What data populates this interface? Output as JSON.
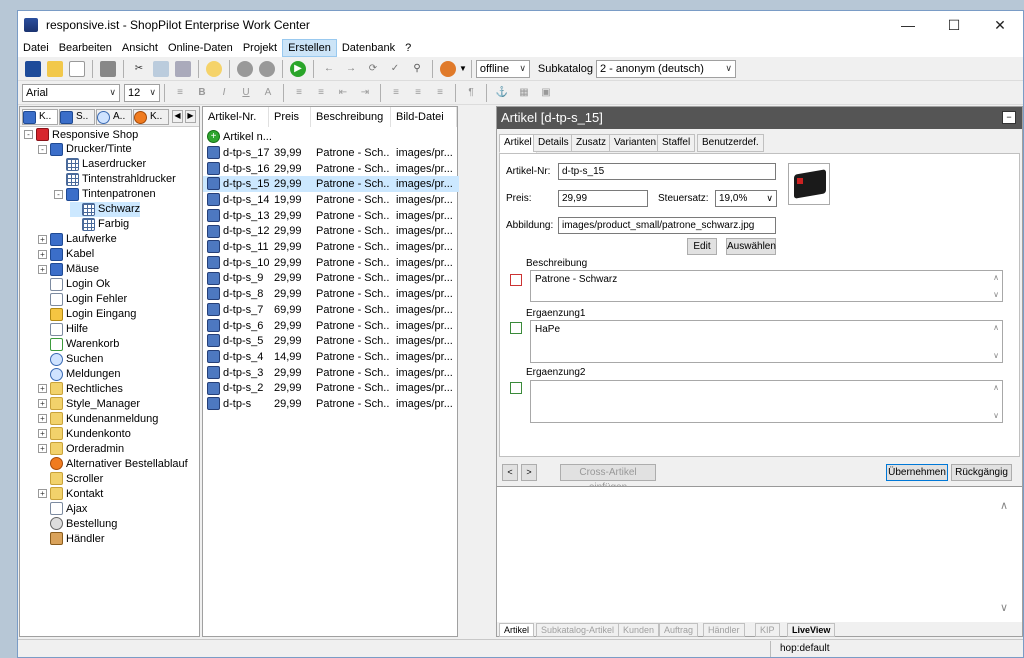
{
  "window": {
    "title": "responsive.ist - ShopPilot Enterprise Work Center"
  },
  "menu": [
    "Datei",
    "Bearbeiten",
    "Ansicht",
    "Online-Daten",
    "Projekt",
    "Erstellen",
    "Datenbank",
    "?"
  ],
  "toolbar1": {
    "status_value": "offline",
    "subkatalog_label": "Subkatalog",
    "subkatalog_value": "2 - anonym (deutsch)"
  },
  "toolbar2": {
    "font_value": "Arial",
    "size_value": "12"
  },
  "side_tabs": [
    "K..",
    "S..",
    "A..",
    "K.."
  ],
  "tree": [
    {
      "label": "Responsive Shop",
      "icon": "root",
      "level": 0,
      "exp": "-"
    },
    {
      "label": "Drucker/Tinte",
      "icon": "book",
      "level": 1,
      "exp": "-"
    },
    {
      "label": "Laserdrucker",
      "icon": "grid",
      "level": 2,
      "exp": ""
    },
    {
      "label": "Tintenstrahldrucker",
      "icon": "grid",
      "level": 2,
      "exp": ""
    },
    {
      "label": "Tintenpatronen",
      "icon": "book",
      "level": 2,
      "exp": "-"
    },
    {
      "label": "Schwarz",
      "icon": "grid",
      "level": 3,
      "exp": ""
    },
    {
      "label": "Farbig",
      "icon": "grid",
      "level": 3,
      "exp": ""
    },
    {
      "label": "Laufwerke",
      "icon": "book",
      "level": 1,
      "exp": "+"
    },
    {
      "label": "Kabel",
      "icon": "book",
      "level": 1,
      "exp": "+"
    },
    {
      "label": "Mäuse",
      "icon": "book",
      "level": 1,
      "exp": "+"
    },
    {
      "label": "Login Ok",
      "icon": "page",
      "level": 1,
      "exp": ""
    },
    {
      "label": "Login Fehler",
      "icon": "page",
      "level": 1,
      "exp": ""
    },
    {
      "label": "Login Eingang",
      "icon": "lock",
      "level": 1,
      "exp": ""
    },
    {
      "label": "Hilfe",
      "icon": "page",
      "level": 1,
      "exp": ""
    },
    {
      "label": "Warenkorb",
      "icon": "cart",
      "level": 1,
      "exp": ""
    },
    {
      "label": "Suchen",
      "icon": "search",
      "level": 1,
      "exp": ""
    },
    {
      "label": "Meldungen",
      "icon": "search",
      "level": 1,
      "exp": ""
    },
    {
      "label": "Rechtliches",
      "icon": "folder",
      "level": 1,
      "exp": "+"
    },
    {
      "label": "Style_Manager",
      "icon": "folder",
      "level": 1,
      "exp": "+"
    },
    {
      "label": "Kundenanmeldung",
      "icon": "folder",
      "level": 1,
      "exp": "+"
    },
    {
      "label": "Kundenkonto",
      "icon": "folder",
      "level": 1,
      "exp": "+"
    },
    {
      "label": "Orderadmin",
      "icon": "folder",
      "level": 1,
      "exp": "+"
    },
    {
      "label": "Alternativer Bestellablauf",
      "icon": "fox",
      "level": 1,
      "exp": ""
    },
    {
      "label": "Scroller",
      "icon": "folder",
      "level": 1,
      "exp": ""
    },
    {
      "label": "Kontakt",
      "icon": "folder",
      "level": 1,
      "exp": "+"
    },
    {
      "label": "Ajax",
      "icon": "page",
      "level": 1,
      "exp": ""
    },
    {
      "label": "Bestellung",
      "icon": "euro",
      "level": 1,
      "exp": ""
    },
    {
      "label": "Händler",
      "icon": "bag",
      "level": 1,
      "exp": ""
    }
  ],
  "list": {
    "headers": [
      "Artikel-Nr.",
      "Preis",
      "Beschreibung",
      "Bild-Datei"
    ],
    "new_label": "Artikel n...",
    "rows": [
      {
        "nr": "d-tp-s_17",
        "preis": "39,99",
        "beschr": "Patrone - Sch...",
        "bild": "images/pr..."
      },
      {
        "nr": "d-tp-s_16",
        "preis": "29,99",
        "beschr": "Patrone - Sch...",
        "bild": "images/pr..."
      },
      {
        "nr": "d-tp-s_15",
        "preis": "29,99",
        "beschr": "Patrone - Sch...",
        "bild": "images/pr..."
      },
      {
        "nr": "d-tp-s_14",
        "preis": "19,99",
        "beschr": "Patrone - Sch...",
        "bild": "images/pr..."
      },
      {
        "nr": "d-tp-s_13",
        "preis": "29,99",
        "beschr": "Patrone - Sch...",
        "bild": "images/pr..."
      },
      {
        "nr": "d-tp-s_12",
        "preis": "29,99",
        "beschr": "Patrone - Sch...",
        "bild": "images/pr..."
      },
      {
        "nr": "d-tp-s_11",
        "preis": "29,99",
        "beschr": "Patrone - Sch...",
        "bild": "images/pr..."
      },
      {
        "nr": "d-tp-s_10",
        "preis": "29,99",
        "beschr": "Patrone - Sch...",
        "bild": "images/pr..."
      },
      {
        "nr": "d-tp-s_9",
        "preis": "29,99",
        "beschr": "Patrone - Sch...",
        "bild": "images/pr..."
      },
      {
        "nr": "d-tp-s_8",
        "preis": "29,99",
        "beschr": "Patrone - Sch...",
        "bild": "images/pr..."
      },
      {
        "nr": "d-tp-s_7",
        "preis": "69,99",
        "beschr": "Patrone - Sch...",
        "bild": "images/pr..."
      },
      {
        "nr": "d-tp-s_6",
        "preis": "29,99",
        "beschr": "Patrone - Sch...",
        "bild": "images/pr..."
      },
      {
        "nr": "d-tp-s_5",
        "preis": "29,99",
        "beschr": "Patrone - Sch...",
        "bild": "images/pr..."
      },
      {
        "nr": "d-tp-s_4",
        "preis": "14,99",
        "beschr": "Patrone - Sch...",
        "bild": "images/pr..."
      },
      {
        "nr": "d-tp-s_3",
        "preis": "29,99",
        "beschr": "Patrone - Sch...",
        "bild": "images/pr..."
      },
      {
        "nr": "d-tp-s_2",
        "preis": "29,99",
        "beschr": "Patrone - Sch...",
        "bild": "images/pr..."
      },
      {
        "nr": "d-tp-s",
        "preis": "29,99",
        "beschr": "Patrone - Sch...",
        "bild": "images/pr..."
      }
    ]
  },
  "detail": {
    "header": "Artikel  [d-tp-s_15]",
    "tabs": [
      "Artikel",
      "Details",
      "Zusatz",
      "Varianten",
      "Staffel",
      "Benutzerdef."
    ],
    "artikel_nr_label": "Artikel-Nr:",
    "artikel_nr_value": "d-tp-s_15",
    "preis_label": "Preis:",
    "preis_value": "29,99",
    "steuer_label": "Steuersatz:",
    "steuer_value": "19,0%",
    "abbildung_label": "Abbildung:",
    "abbildung_value": "images/product_small/patrone_schwarz.jpg",
    "edit_label": "Edit",
    "auswaehlen_label": "Auswählen",
    "beschreibung_label": "Beschreibung",
    "beschreibung_value": "Patrone - Schwarz",
    "ergaenzung1_label": "Ergaenzung1",
    "ergaenzung1_value": "HaPe",
    "ergaenzung2_label": "Ergaenzung2",
    "ergaenzung2_value": "",
    "cross_label": "Cross-Artikel einfügen",
    "uebernehmen_label": "Übernehmen",
    "rueckgaengig_label": "Rückgängig"
  },
  "bottom_tabs": [
    "Artikel",
    "Subkatalog-Artikel",
    "Kunden",
    "Auftrag",
    "Händler",
    "KIP",
    "LiveView"
  ],
  "statusbar": {
    "right": "hop:default"
  }
}
